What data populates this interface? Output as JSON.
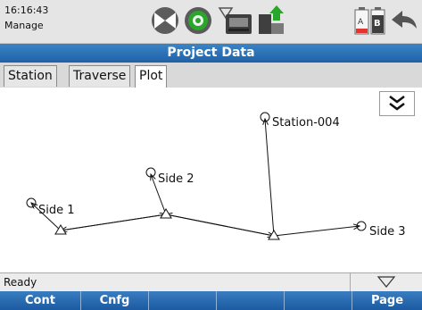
{
  "header": {
    "time": "16:16:43",
    "mode": "Manage"
  },
  "icons": [
    "compass-icon",
    "gps-satellite-icon",
    "signal-icon",
    "memory-card-icon",
    "data-transfer-icon",
    "battery-ab-icon",
    "back-arrow-icon"
  ],
  "title": "Project Data",
  "tabs": [
    {
      "label": "Station"
    },
    {
      "label": "Traverse"
    },
    {
      "label": "Plot"
    }
  ],
  "active_tab": "Plot",
  "plot": {
    "stations": [
      {
        "label": "Station-004"
      }
    ],
    "sides": [
      {
        "label": "Side 1"
      },
      {
        "label": "Side 2"
      },
      {
        "label": "Side 3"
      }
    ]
  },
  "status": {
    "text": "Ready"
  },
  "softkeys": [
    {
      "label": "Cont"
    },
    {
      "label": "Cnfg"
    },
    {
      "label": ""
    },
    {
      "label": ""
    },
    {
      "label": ""
    },
    {
      "label": "Page"
    }
  ],
  "colors": {
    "title_bar": "#2a6fb6",
    "softkey_bar": "#2866ae",
    "gps_green": "#2aa62a",
    "battery_red": "#e33434"
  }
}
